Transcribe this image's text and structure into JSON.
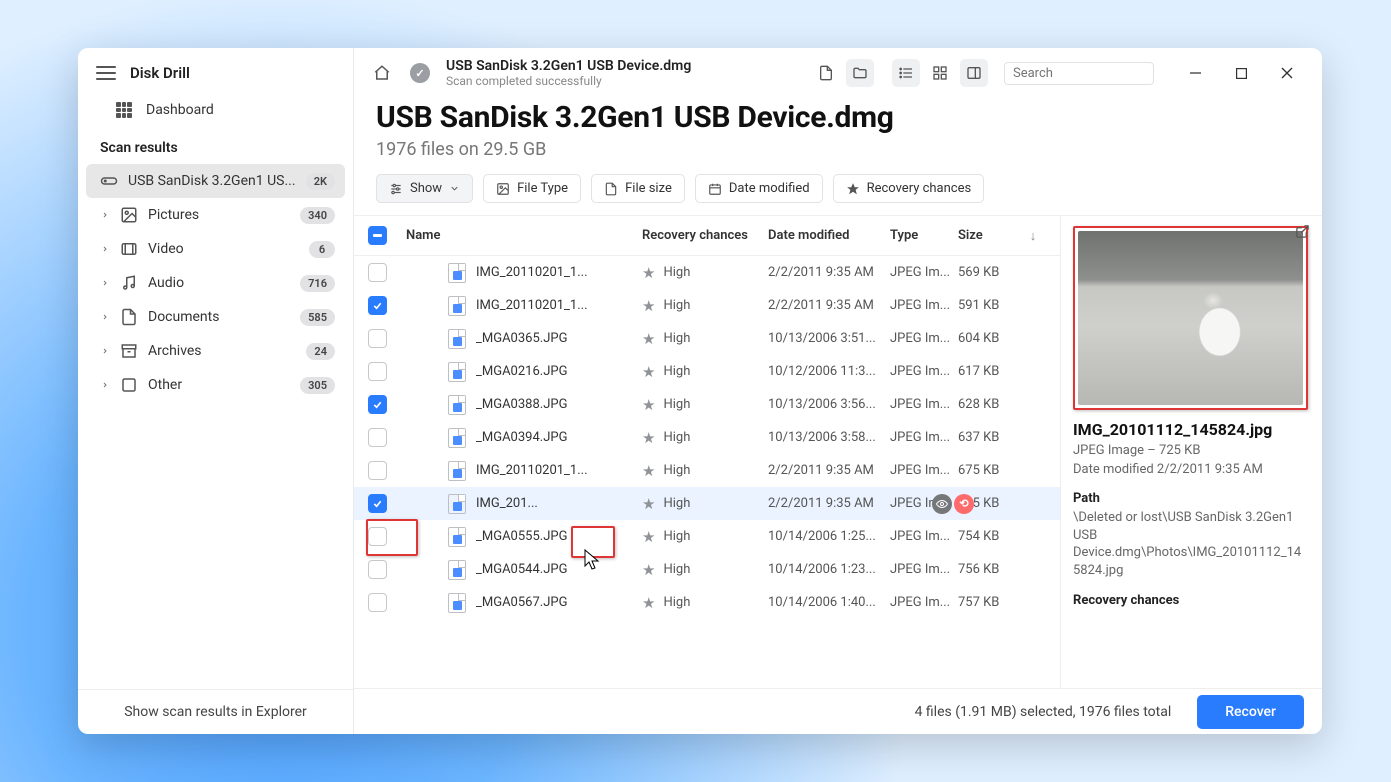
{
  "app": {
    "title": "Disk Drill"
  },
  "dashboard": {
    "label": "Dashboard"
  },
  "scan_results": {
    "label": "Scan results",
    "items": [
      {
        "name": "USB  SanDisk 3.2Gen1 US...",
        "badge": "2K",
        "active": true,
        "icon": "drive"
      },
      {
        "name": "Pictures",
        "badge": "340",
        "icon": "picture"
      },
      {
        "name": "Video",
        "badge": "6",
        "icon": "video"
      },
      {
        "name": "Audio",
        "badge": "716",
        "icon": "audio"
      },
      {
        "name": "Documents",
        "badge": "585",
        "icon": "document"
      },
      {
        "name": "Archives",
        "badge": "24",
        "icon": "archive"
      },
      {
        "name": "Other",
        "badge": "305",
        "icon": "other"
      }
    ]
  },
  "sidebar_footer": "Show scan results in Explorer",
  "breadcrumb": {
    "title": "USB  SanDisk 3.2Gen1 USB Device.dmg",
    "subtitle": "Scan completed successfully"
  },
  "search": {
    "placeholder": "Search"
  },
  "heading": {
    "title": "USB  SanDisk 3.2Gen1 USB Device.dmg",
    "subtitle": "1976 files on 29.5 GB"
  },
  "filters": {
    "show": "Show",
    "file_type": "File Type",
    "file_size": "File size",
    "date_modified": "Date modified",
    "recovery_chances": "Recovery chances"
  },
  "columns": {
    "name": "Name",
    "recovery": "Recovery chances",
    "date": "Date modified",
    "type": "Type",
    "size": "Size"
  },
  "files": [
    {
      "checked": false,
      "name": "IMG_20110201_1...",
      "rec": "High",
      "date": "2/2/2011 9:35 AM",
      "type": "JPEG Im...",
      "size": "569 KB"
    },
    {
      "checked": true,
      "name": "IMG_20110201_1...",
      "rec": "High",
      "date": "2/2/2011 9:35 AM",
      "type": "JPEG Im...",
      "size": "591 KB"
    },
    {
      "checked": false,
      "name": "_MGA0365.JPG",
      "rec": "High",
      "date": "10/13/2006 3:51...",
      "type": "JPEG Im...",
      "size": "604 KB"
    },
    {
      "checked": false,
      "name": "_MGA0216.JPG",
      "rec": "High",
      "date": "10/12/2006 11:3...",
      "type": "JPEG Im...",
      "size": "617 KB"
    },
    {
      "checked": true,
      "name": "_MGA0388.JPG",
      "rec": "High",
      "date": "10/13/2006 3:56...",
      "type": "JPEG Im...",
      "size": "628 KB"
    },
    {
      "checked": false,
      "name": "_MGA0394.JPG",
      "rec": "High",
      "date": "10/13/2006 3:58...",
      "type": "JPEG Im...",
      "size": "637 KB"
    },
    {
      "checked": false,
      "name": "IMG_20110201_1...",
      "rec": "High",
      "date": "2/2/2011 9:35 AM",
      "type": "JPEG Im...",
      "size": "675 KB"
    },
    {
      "checked": true,
      "name": "IMG_201...",
      "rec": "High",
      "date": "2/2/2011 9:35 AM",
      "type": "JPEG Im...",
      "size": "725 KB",
      "selected": true,
      "hover": true
    },
    {
      "checked": false,
      "name": "_MGA0555.JPG",
      "rec": "High",
      "date": "10/14/2006 1:25...",
      "type": "JPEG Im...",
      "size": "754 KB"
    },
    {
      "checked": false,
      "name": "_MGA0544.JPG",
      "rec": "High",
      "date": "10/14/2006 1:23...",
      "type": "JPEG Im...",
      "size": "756 KB"
    },
    {
      "checked": false,
      "name": "_MGA0567.JPG",
      "rec": "High",
      "date": "10/14/2006 1:40...",
      "type": "JPEG Im...",
      "size": "757 KB"
    }
  ],
  "detail": {
    "title": "IMG_20101112_145824.jpg",
    "meta": "JPEG Image – 725 KB",
    "modified": "Date modified 2/2/2011 9:35 AM",
    "path_label": "Path",
    "path": "\\Deleted or lost\\USB  SanDisk 3.2Gen1 USB Device.dmg\\Photos\\IMG_20101112_145824.jpg",
    "recovery_label": "Recovery chances"
  },
  "status": {
    "text": "4 files (1.91 MB) selected, 1976 files total",
    "recover": "Recover"
  }
}
